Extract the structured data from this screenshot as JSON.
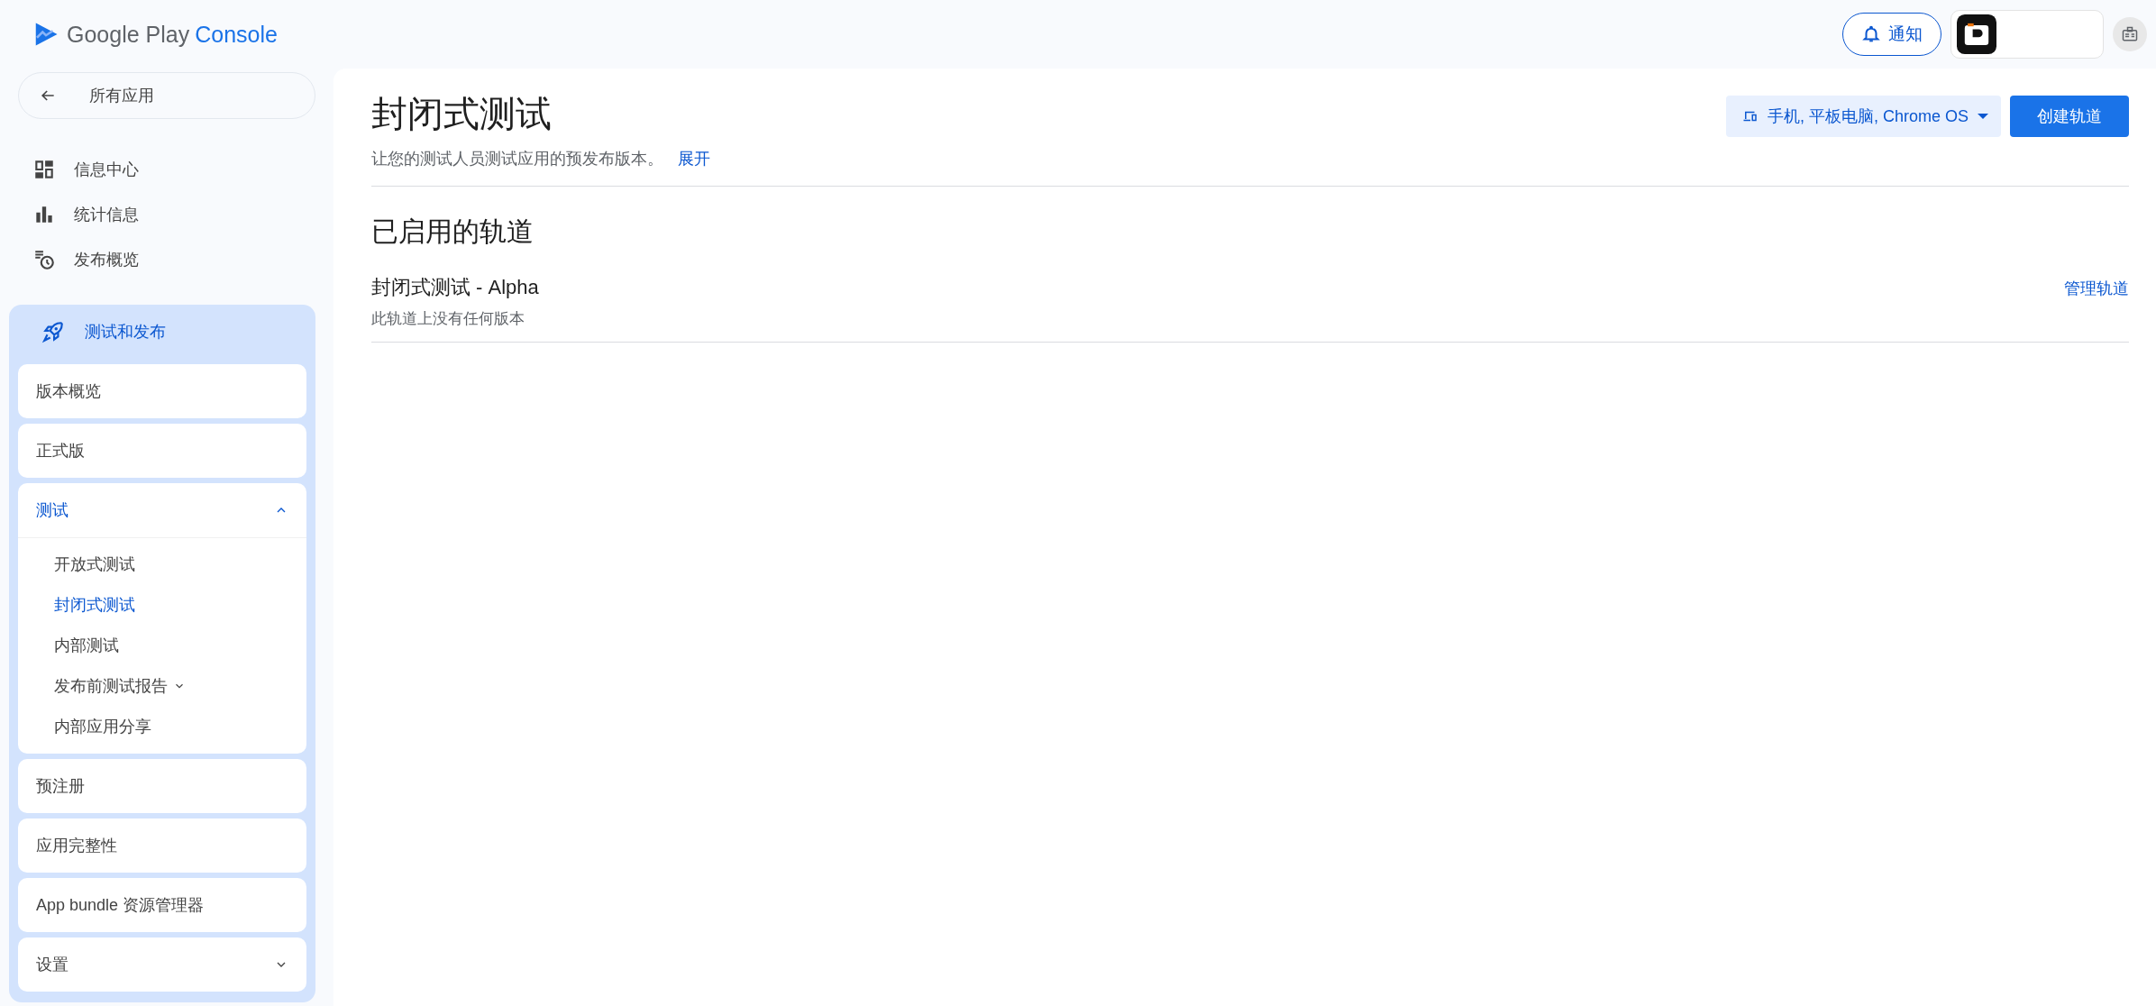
{
  "app_bar": {
    "logo": {
      "product": "Google Play",
      "suffix": "Console"
    },
    "notifications_button": "通知"
  },
  "sidebar": {
    "back_link": "所有应用",
    "nav_items": [
      {
        "label": "信息中心"
      },
      {
        "label": "统计信息"
      },
      {
        "label": "发布概览"
      }
    ],
    "section": {
      "title": "测试和发布",
      "items": [
        {
          "label": "版本概览",
          "kind": "link",
          "selected": false
        },
        {
          "label": "正式版",
          "kind": "link",
          "selected": false
        },
        {
          "label": "测试",
          "kind": "group",
          "selected": true,
          "expanded": true,
          "children": [
            {
              "label": "开放式测试",
              "kind": "link",
              "selected": false
            },
            {
              "label": "封闭式测试",
              "kind": "link",
              "selected": true
            },
            {
              "label": "内部测试",
              "kind": "link",
              "selected": false
            },
            {
              "label": "发布前测试报告",
              "kind": "expandable",
              "selected": false
            },
            {
              "label": "内部应用分享",
              "kind": "link",
              "selected": false
            }
          ]
        },
        {
          "label": "预注册",
          "kind": "link",
          "selected": false
        },
        {
          "label": "应用完整性",
          "kind": "link",
          "selected": false
        },
        {
          "label": "App bundle 资源管理器",
          "kind": "link",
          "selected": false
        },
        {
          "label": "设置",
          "kind": "group",
          "selected": false,
          "expanded": false
        }
      ]
    }
  },
  "main": {
    "title": "封闭式测试",
    "description": "让您的测试人员测试应用的预发布版本。",
    "expand_link": "展开",
    "platform_select": "手机, 平板电脑, Chrome OS",
    "create_button": "创建轨道",
    "section_title": "已启用的轨道",
    "tracks": [
      {
        "name": "封闭式测试 - Alpha",
        "status": "此轨道上没有任何版本",
        "action": "管理轨道"
      }
    ]
  }
}
